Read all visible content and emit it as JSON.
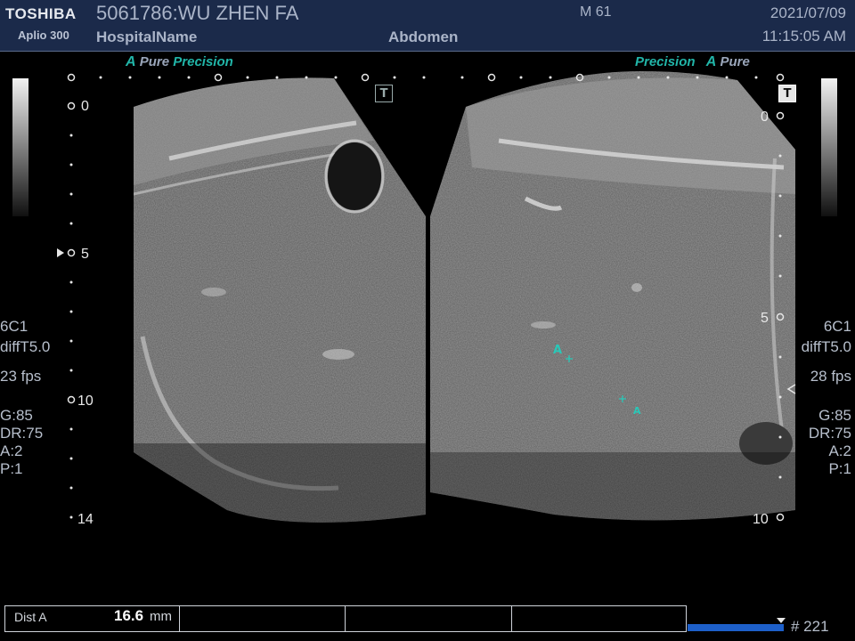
{
  "header": {
    "brand": "TOSHIBA",
    "model": "Aplio 300",
    "patient": "5061786:WU ZHEN FA",
    "hospital": "HospitalName",
    "preset": "Abdomen",
    "mindex": "M 61",
    "date": "2021/07/09",
    "time": "11:15:05 AM"
  },
  "left_image": {
    "tag_a": "A",
    "tag_pure": "Pure",
    "tag_precision": "Precision",
    "badge": "T",
    "depth_labels": [
      "0",
      "5",
      "10",
      "14"
    ],
    "params": {
      "probe": "6C1",
      "filter": "diffT5.0",
      "fps": "23 fps",
      "gain": "G:85",
      "dr": "DR:75",
      "a": "A:2",
      "p": "P:1"
    }
  },
  "right_image": {
    "tag_precision": "Precision",
    "tag_a": "A",
    "tag_pure": "Pure",
    "badge": "T",
    "depth_labels": [
      "0",
      "5",
      "10"
    ],
    "params": {
      "probe": "6C1",
      "filter": "diffT5.0",
      "fps": "28 fps",
      "gain": "G:85",
      "dr": "DR:75",
      "a": "A:2",
      "p": "P:1"
    },
    "caliper_label": "A"
  },
  "measurement": {
    "label": "Dist A",
    "value": "16.6",
    "unit": "mm"
  },
  "cine": {
    "frame": "# 221"
  },
  "colors": {
    "header_bg": "#1b2a4a",
    "accent": "#21b5a8",
    "cine_bar": "#1d5fc9"
  },
  "icons": {
    "focus_marker": "focus-arrow-icon",
    "caliper": "caliper-cross-icon"
  }
}
